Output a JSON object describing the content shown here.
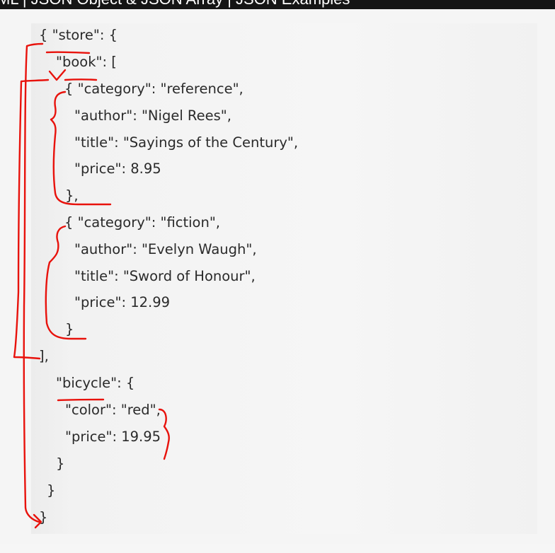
{
  "header": {
    "title": "ML | JSON Object & JSON Array | JSON Examples"
  },
  "code_lines": [
    "{ \"store\": {",
    "\"book\": [",
    "{ \"category\": \"reference\",",
    "\"author\": \"Nigel Rees\",",
    "\"title\": \"Sayings of the Century\",",
    "\"price\": 8.95",
    "},",
    "{ \"category\": \"fiction\",",
    "\"author\": \"Evelyn Waugh\",",
    "\"title\": \"Sword of Honour\",",
    "\"price\": 12.99",
    "}",
    "],",
    "\"bicycle\": {",
    "\"color\": \"red\",",
    "\"price\": 19.95",
    "}",
    "}",
    "}"
  ],
  "annotation": {
    "color": "#e8120c"
  }
}
